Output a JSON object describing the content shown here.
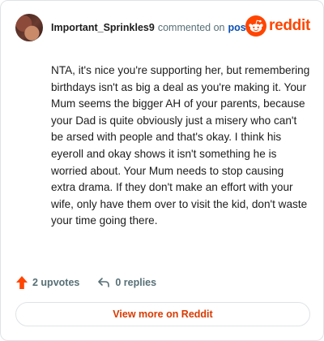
{
  "comment": {
    "username": "Important_Sprinkles9",
    "action_text": "commented on",
    "post_link": "post",
    "body": "NTA, it's nice you're supporting her, but remembering birthdays isn't as big a deal as you're making it. Your Mum seems the bigger AH of your parents, because your Dad is quite obviously just a misery who can't be arsed with people and that's okay. I think his eyeroll and okay shows it isn't something he is worried about. Your Mum needs to stop causing extra drama. If they don't make an effort with your wife, only have them over to visit the kid, don't waste your time going there."
  },
  "brand": {
    "logo_text": "reddit",
    "accent_color": "#ff4500"
  },
  "actions": {
    "upvotes": "2 upvotes",
    "replies": "0 replies",
    "upvote_icon": "upvote-arrow-icon",
    "reply_icon": "reply-icon"
  },
  "footer": {
    "view_more": "View more on Reddit"
  }
}
